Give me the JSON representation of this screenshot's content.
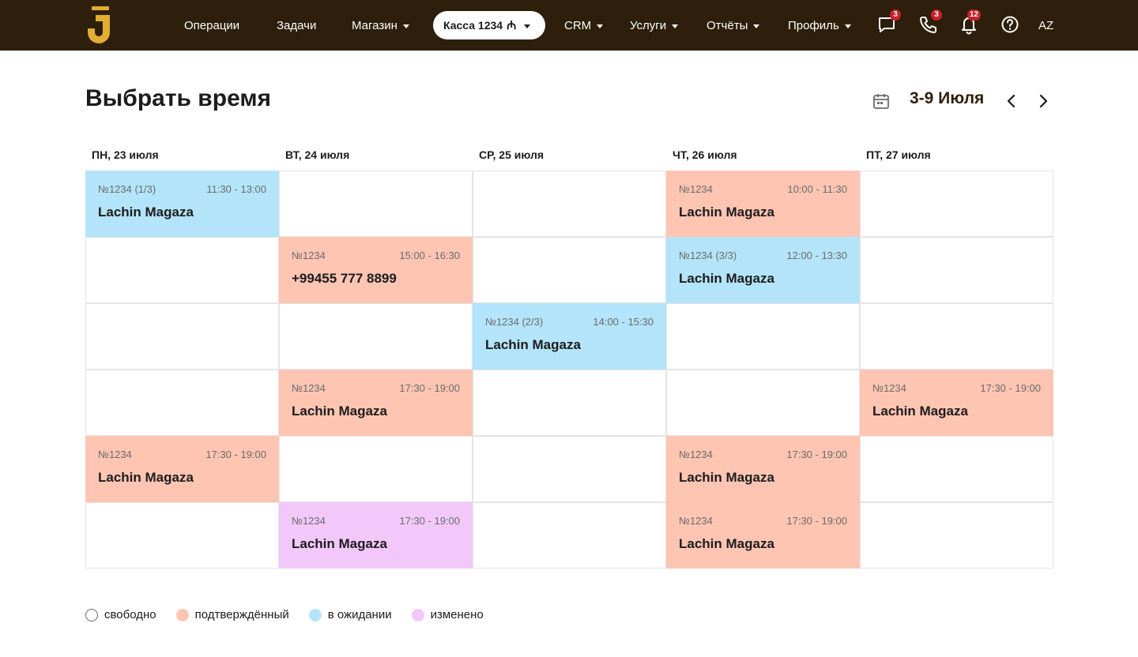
{
  "nav": {
    "items": [
      {
        "label": "Операции",
        "dropdown": false
      },
      {
        "label": "Задачи",
        "dropdown": false
      },
      {
        "label": "Магазин",
        "dropdown": true
      },
      {
        "label": "CRM",
        "dropdown": true
      },
      {
        "label": "Услуги",
        "dropdown": true
      },
      {
        "label": "Отчёты",
        "dropdown": true
      },
      {
        "label": "Профиль",
        "dropdown": true
      }
    ],
    "kassa": {
      "label": "Касса 1234",
      "currency": "₼"
    },
    "icons": [
      {
        "name": "chat-icon",
        "badge": "3"
      },
      {
        "name": "phone-icon",
        "badge": "3"
      },
      {
        "name": "bell-icon",
        "badge": "12"
      },
      {
        "name": "help-icon",
        "badge": ""
      }
    ],
    "lang": "AZ"
  },
  "colors": {
    "topbar": "#2d1f0b",
    "logo": "#e3ac33",
    "confirmed": "#ffc5b3",
    "pending": "#b3e4fa",
    "changed": "#f2c8fb",
    "badge": "#c9202b"
  },
  "header": {
    "title": "Выбрать время",
    "date_range": "3-9 Июля"
  },
  "schedule": {
    "days": [
      "ПН, 23 июля",
      "ВТ, 24 июля",
      "СР, 25 июля",
      "ЧТ, 26 июля",
      "ПТ, 27 июля"
    ],
    "slots": [
      {
        "day": 0,
        "row": 0,
        "status": "pending",
        "code": "№1234 (1/3)",
        "time": "11:30 - 13:00",
        "title": "Lachin Magaza"
      },
      {
        "day": 3,
        "row": 0,
        "status": "confirmed",
        "code": "№1234",
        "time": "10:00 - 11:30",
        "title": "Lachin Magaza"
      },
      {
        "day": 1,
        "row": 1,
        "status": "confirmed",
        "code": "№1234",
        "time": "15:00 - 16:30",
        "title": "+99455 777 8899"
      },
      {
        "day": 3,
        "row": 1,
        "status": "pending",
        "code": "№1234 (3/3)",
        "time": "12:00 - 13:30",
        "title": "Lachin Magaza"
      },
      {
        "day": 2,
        "row": 2,
        "status": "pending",
        "code": "№1234 (2/3)",
        "time": "14:00 - 15:30",
        "title": "Lachin Magaza"
      },
      {
        "day": 1,
        "row": 3,
        "status": "confirmed",
        "code": "№1234",
        "time": "17:30 - 19:00",
        "title": "Lachin Magaza"
      },
      {
        "day": 4,
        "row": 3,
        "status": "confirmed",
        "code": "№1234",
        "time": "17:30 - 19:00",
        "title": "Lachin Magaza"
      },
      {
        "day": 0,
        "row": 4,
        "status": "confirmed",
        "code": "№1234",
        "time": "17:30 - 19:00",
        "title": "Lachin Magaza"
      },
      {
        "day": 3,
        "row": 4,
        "status": "confirmed",
        "code": "№1234",
        "time": "17:30 - 19:00",
        "title": "Lachin Magaza"
      },
      {
        "day": 1,
        "row": 5,
        "status": "changed",
        "code": "№1234",
        "time": "17:30 - 19:00",
        "title": "Lachin Magaza"
      },
      {
        "day": 3,
        "row": 5,
        "status": "confirmed",
        "code": "№1234",
        "time": "17:30 - 19:00",
        "title": "Lachin Magaza"
      }
    ]
  },
  "legend": [
    {
      "status": "free",
      "label": "свободно"
    },
    {
      "status": "confirmed",
      "label": "подтверждённый"
    },
    {
      "status": "pending",
      "label": "в ожидании"
    },
    {
      "status": "changed",
      "label": "изменено"
    }
  ]
}
